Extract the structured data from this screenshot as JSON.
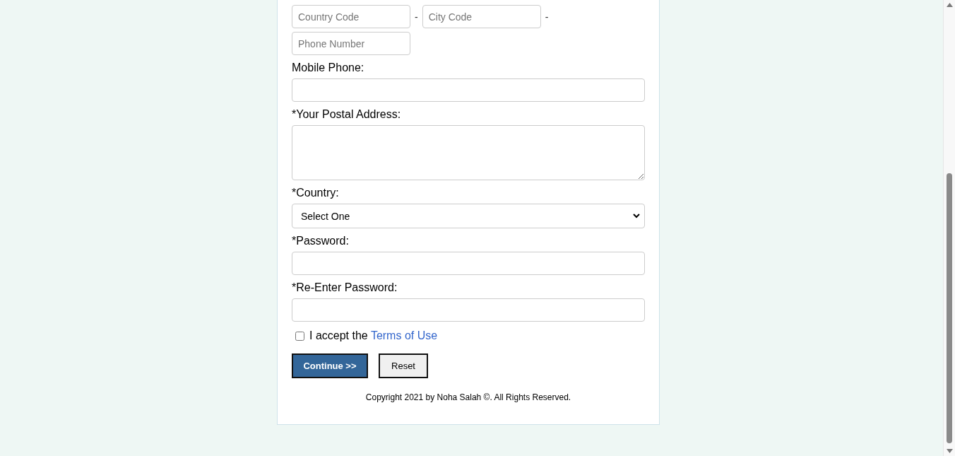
{
  "phone": {
    "country_code": {
      "placeholder": "Country Code"
    },
    "separator_1": "-",
    "city_code": {
      "placeholder": "City Code"
    },
    "separator_2": "-",
    "phone_number": {
      "placeholder": "Phone Number"
    }
  },
  "fields": [
    {
      "kind": "text",
      "label": "Mobile Phone:"
    },
    {
      "kind": "textarea",
      "label": "*Your Postal Address:"
    },
    {
      "kind": "select",
      "label": "*Country:",
      "value": "Select One"
    },
    {
      "kind": "password",
      "label": "*Password:"
    },
    {
      "kind": "password",
      "label": "*Re-Enter Password:"
    }
  ],
  "terms": {
    "checked": false,
    "text": "I accept the ",
    "link": "Terms of Use"
  },
  "buttons": [
    {
      "kind": "primary",
      "label": "Continue >>"
    },
    {
      "kind": "secondary",
      "label": "Reset"
    }
  ],
  "footer": {
    "copyright": "Copyright 2021 by Noha Salah ©. All Rights Reserved."
  }
}
